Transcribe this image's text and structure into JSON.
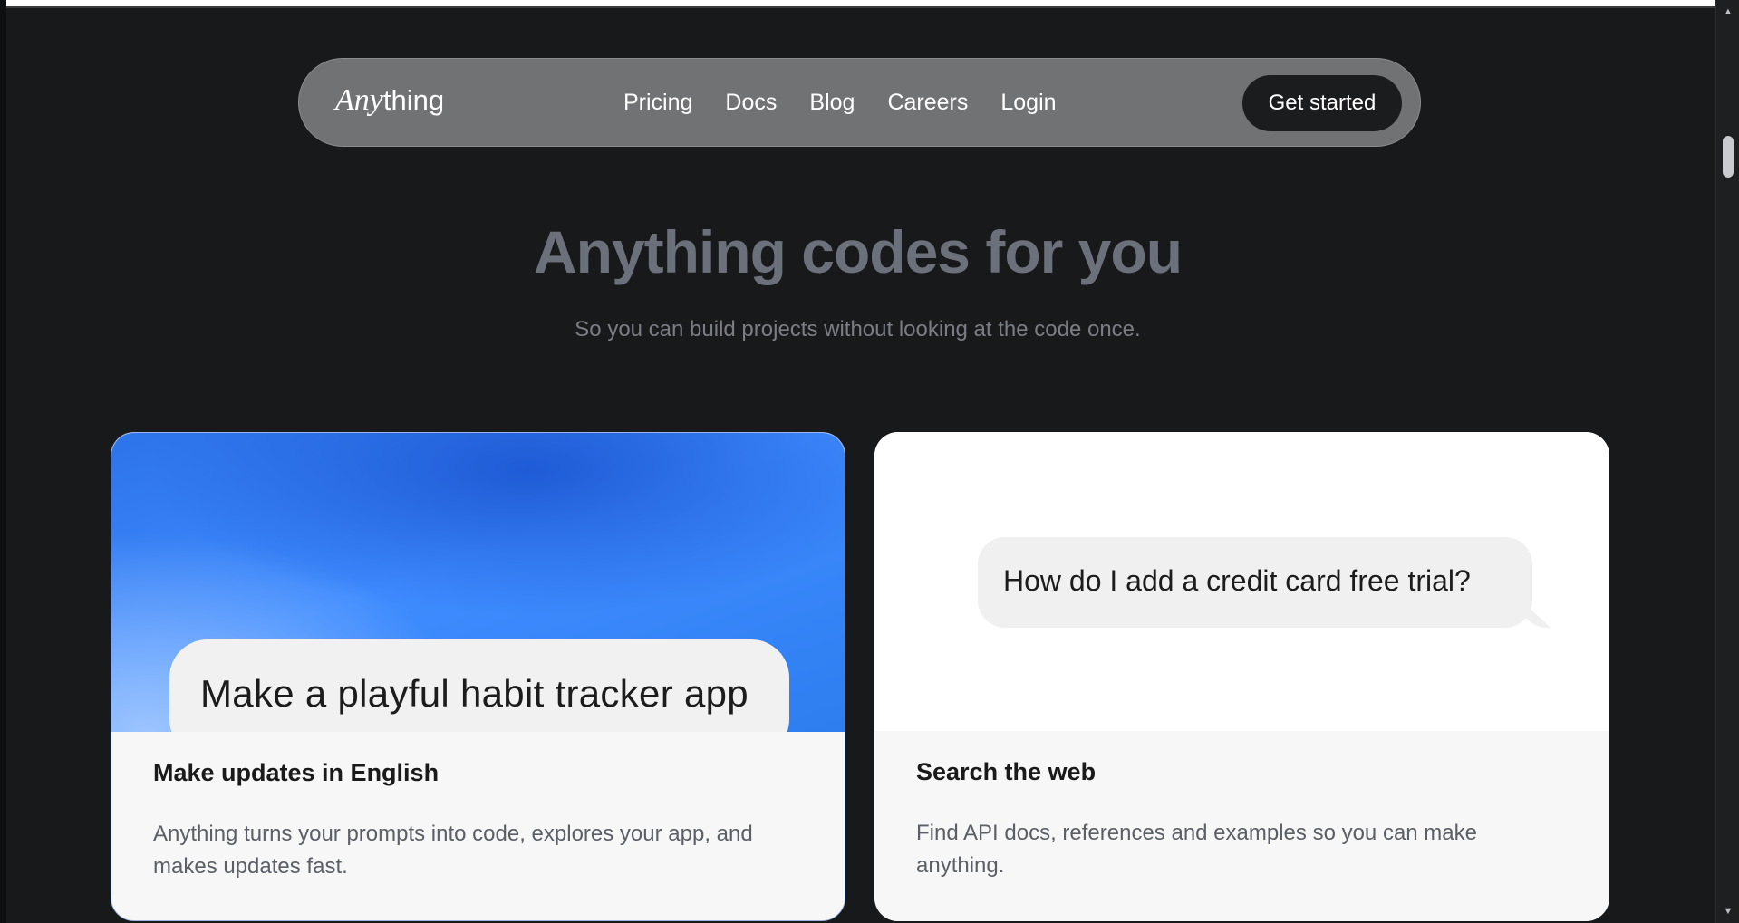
{
  "nav": {
    "logo_italic": "Any",
    "logo_plain": "thing",
    "links": [
      "Pricing",
      "Docs",
      "Blog",
      "Careers",
      "Login"
    ],
    "cta": "Get started"
  },
  "hero": {
    "title": "Anything codes for you",
    "subtitle": "So you can build projects without looking at the code once."
  },
  "cards": [
    {
      "bubble": "Make a playful habit tracker app",
      "title": "Make updates in English",
      "description": "Anything turns your prompts into code, explores your app, and makes updates fast."
    },
    {
      "bubble": "How do I add a credit card free trial?",
      "title": "Search the web",
      "description": "Find API docs, references and examples so you can make anything."
    }
  ],
  "colors": {
    "background": "#18191b",
    "nav_pill": "#717274",
    "cta_bg": "#1b1c1e",
    "hero_title": "#6c707a",
    "card_blue": "#3f8cff"
  }
}
